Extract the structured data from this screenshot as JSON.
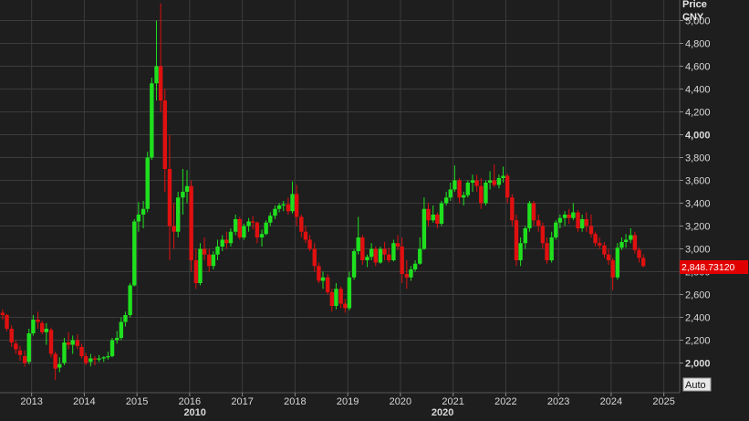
{
  "axis": {
    "price_label": "Price",
    "currency_label": "CNY",
    "auto_label": "Auto",
    "last_price_label": "2,848.73120"
  },
  "colors": {
    "background": "#1e1e1e",
    "grid": "#3c3c3c",
    "up": "#1fe01f",
    "down": "#e01010",
    "axis_text": "#d8d8d8",
    "price_tag": "#e00000"
  },
  "chart_data": {
    "type": "candlestick",
    "title": "",
    "ylabel": "Price CNY",
    "ylim": [
      1740,
      5180
    ],
    "xlim": [
      2012.4,
      2025.3
    ],
    "y_ticks": [
      {
        "value": 2000,
        "label": "2,000",
        "bold": true
      },
      {
        "value": 2200,
        "label": "2,200",
        "bold": false
      },
      {
        "value": 2400,
        "label": "2,400",
        "bold": false
      },
      {
        "value": 2600,
        "label": "2,600",
        "bold": false
      },
      {
        "value": 2800,
        "label": "2,800",
        "bold": false
      },
      {
        "value": 3000,
        "label": "3,000",
        "bold": false
      },
      {
        "value": 3200,
        "label": "3,200",
        "bold": false
      },
      {
        "value": 3400,
        "label": "3,400",
        "bold": false
      },
      {
        "value": 3600,
        "label": "3,600",
        "bold": false
      },
      {
        "value": 3800,
        "label": "3,800",
        "bold": false
      },
      {
        "value": 4000,
        "label": "4,000",
        "bold": true
      },
      {
        "value": 4200,
        "label": "4,200",
        "bold": false
      },
      {
        "value": 4400,
        "label": "4,400",
        "bold": false
      },
      {
        "value": 4600,
        "label": "4,600",
        "bold": false
      },
      {
        "value": 4800,
        "label": "4,800",
        "bold": false
      },
      {
        "value": 5000,
        "label": "5,000",
        "bold": false
      }
    ],
    "x_ticks": [
      {
        "value": 2013,
        "label": "2013"
      },
      {
        "value": 2014,
        "label": "2014"
      },
      {
        "value": 2015,
        "label": "2015"
      },
      {
        "value": 2016,
        "label": "2016"
      },
      {
        "value": 2017,
        "label": "2017"
      },
      {
        "value": 2018,
        "label": "2018"
      },
      {
        "value": 2019,
        "label": "2019"
      },
      {
        "value": 2020,
        "label": "2020"
      },
      {
        "value": 2021,
        "label": "2021"
      },
      {
        "value": 2022,
        "label": "2022"
      },
      {
        "value": 2023,
        "label": "2023"
      },
      {
        "value": 2024,
        "label": "2024"
      },
      {
        "value": 2025,
        "label": "2025"
      }
    ],
    "decade_labels": [
      {
        "value": 2010,
        "label": "2010",
        "x_position": 2016.1
      },
      {
        "value": 2020,
        "label": "2020",
        "x_position": 2020.8
      }
    ],
    "last_price": 2848.7312,
    "candles": [
      [
        2012.45,
        2440,
        2470,
        2380,
        2420
      ],
      [
        2012.53,
        2420,
        2430,
        2280,
        2300
      ],
      [
        2012.62,
        2300,
        2330,
        2140,
        2180
      ],
      [
        2012.7,
        2170,
        2200,
        2080,
        2120
      ],
      [
        2012.78,
        2110,
        2150,
        2020,
        2070
      ],
      [
        2012.87,
        2060,
        2110,
        1970,
        2000
      ],
      [
        2012.95,
        2010,
        2300,
        1990,
        2260
      ],
      [
        2013.03,
        2260,
        2420,
        2240,
        2380
      ],
      [
        2013.12,
        2380,
        2450,
        2300,
        2360
      ],
      [
        2013.2,
        2350,
        2370,
        2250,
        2270
      ],
      [
        2013.28,
        2270,
        2350,
        2160,
        2300
      ],
      [
        2013.37,
        2290,
        2310,
        2050,
        2080
      ],
      [
        2013.45,
        2080,
        2100,
        1850,
        1950
      ],
      [
        2013.53,
        1960,
        2050,
        1920,
        1990
      ],
      [
        2013.62,
        2000,
        2220,
        1980,
        2180
      ],
      [
        2013.7,
        2180,
        2270,
        2120,
        2160
      ],
      [
        2013.78,
        2160,
        2240,
        2080,
        2200
      ],
      [
        2013.87,
        2200,
        2250,
        2120,
        2150
      ],
      [
        2013.95,
        2140,
        2170,
        2040,
        2060
      ],
      [
        2014.03,
        2060,
        2090,
        1980,
        2000
      ],
      [
        2014.12,
        2010,
        2080,
        1970,
        2040
      ],
      [
        2014.2,
        2040,
        2060,
        1980,
        2030
      ],
      [
        2014.28,
        2030,
        2070,
        2010,
        2040
      ],
      [
        2014.37,
        2040,
        2060,
        2010,
        2050
      ],
      [
        2014.45,
        2050,
        2100,
        2030,
        2060
      ],
      [
        2014.53,
        2060,
        2220,
        2050,
        2200
      ],
      [
        2014.62,
        2200,
        2280,
        2170,
        2220
      ],
      [
        2014.7,
        2220,
        2400,
        2200,
        2360
      ],
      [
        2014.78,
        2360,
        2450,
        2320,
        2420
      ],
      [
        2014.87,
        2420,
        2700,
        2400,
        2680
      ],
      [
        2014.95,
        2680,
        3260,
        2670,
        3240
      ],
      [
        2015.03,
        3240,
        3410,
        3150,
        3300
      ],
      [
        2015.12,
        3300,
        3420,
        3180,
        3350
      ],
      [
        2015.2,
        3350,
        3850,
        3320,
        3800
      ],
      [
        2015.28,
        3800,
        4500,
        3780,
        4450
      ],
      [
        2015.37,
        4450,
        5000,
        4300,
        4600
      ],
      [
        2015.45,
        4600,
        5150,
        4200,
        4300
      ],
      [
        2015.53,
        4300,
        4400,
        3500,
        3700
      ],
      [
        2015.62,
        3700,
        4000,
        2900,
        3200
      ],
      [
        2015.7,
        3200,
        3400,
        3000,
        3150
      ],
      [
        2015.78,
        3150,
        3500,
        3100,
        3450
      ],
      [
        2015.87,
        3450,
        3700,
        3300,
        3500
      ],
      [
        2015.95,
        3500,
        3690,
        3400,
        3550
      ],
      [
        2016.03,
        3550,
        3600,
        2800,
        2900
      ],
      [
        2016.12,
        2900,
        3000,
        2650,
        2700
      ],
      [
        2016.2,
        2700,
        3050,
        2680,
        3000
      ],
      [
        2016.28,
        3000,
        3100,
        2900,
        2950
      ],
      [
        2016.37,
        2950,
        3000,
        2800,
        2850
      ],
      [
        2016.45,
        2850,
        2980,
        2820,
        2950
      ],
      [
        2016.53,
        2950,
        3080,
        2900,
        3020
      ],
      [
        2016.62,
        3020,
        3120,
        2980,
        3080
      ],
      [
        2016.7,
        3080,
        3150,
        3000,
        3050
      ],
      [
        2016.78,
        3050,
        3180,
        3020,
        3150
      ],
      [
        2016.87,
        3150,
        3300,
        3120,
        3260
      ],
      [
        2016.95,
        3260,
        3280,
        3080,
        3100
      ],
      [
        2017.03,
        3100,
        3220,
        3080,
        3200
      ],
      [
        2017.12,
        3200,
        3270,
        3150,
        3240
      ],
      [
        2017.2,
        3240,
        3290,
        3170,
        3230
      ],
      [
        2017.28,
        3230,
        3240,
        3050,
        3100
      ],
      [
        2017.37,
        3100,
        3170,
        3020,
        3130
      ],
      [
        2017.45,
        3130,
        3250,
        3120,
        3230
      ],
      [
        2017.53,
        3230,
        3320,
        3200,
        3290
      ],
      [
        2017.62,
        3290,
        3380,
        3260,
        3350
      ],
      [
        2017.7,
        3350,
        3400,
        3320,
        3380
      ],
      [
        2017.78,
        3380,
        3420,
        3330,
        3390
      ],
      [
        2017.87,
        3390,
        3450,
        3300,
        3330
      ],
      [
        2017.95,
        3330,
        3590,
        3310,
        3480
      ],
      [
        2018.03,
        3480,
        3560,
        3200,
        3280
      ],
      [
        2018.12,
        3280,
        3300,
        3100,
        3150
      ],
      [
        2018.2,
        3150,
        3200,
        3050,
        3080
      ],
      [
        2018.28,
        3080,
        3120,
        2980,
        3000
      ],
      [
        2018.37,
        3000,
        3050,
        2800,
        2850
      ],
      [
        2018.45,
        2850,
        2880,
        2700,
        2720
      ],
      [
        2018.53,
        2720,
        2800,
        2650,
        2750
      ],
      [
        2018.62,
        2750,
        2780,
        2600,
        2620
      ],
      [
        2018.7,
        2620,
        2650,
        2450,
        2500
      ],
      [
        2018.78,
        2500,
        2700,
        2470,
        2650
      ],
      [
        2018.87,
        2650,
        2670,
        2480,
        2520
      ],
      [
        2018.95,
        2520,
        2560,
        2440,
        2480
      ],
      [
        2019.03,
        2480,
        2800,
        2460,
        2750
      ],
      [
        2019.12,
        2750,
        3000,
        2730,
        2980
      ],
      [
        2019.2,
        2980,
        3280,
        2950,
        3100
      ],
      [
        2019.28,
        3100,
        3120,
        2860,
        2900
      ],
      [
        2019.37,
        2900,
        2950,
        2840,
        2930
      ],
      [
        2019.45,
        2930,
        3050,
        2900,
        3000
      ],
      [
        2019.53,
        3000,
        3020,
        2850,
        2880
      ],
      [
        2019.62,
        2880,
        3020,
        2870,
        3000
      ],
      [
        2019.7,
        3000,
        3060,
        2900,
        2950
      ],
      [
        2019.78,
        2950,
        3010,
        2880,
        2900
      ],
      [
        2019.87,
        2900,
        3080,
        2890,
        3050
      ],
      [
        2019.95,
        3050,
        3120,
        2990,
        3020
      ],
      [
        2020.03,
        3020,
        3100,
        2700,
        2780
      ],
      [
        2020.12,
        2780,
        2900,
        2650,
        2750
      ],
      [
        2020.2,
        2750,
        2850,
        2720,
        2820
      ],
      [
        2020.28,
        2820,
        2900,
        2800,
        2870
      ],
      [
        2020.37,
        2870,
        3100,
        2860,
        3000
      ],
      [
        2020.45,
        3000,
        3450,
        2990,
        3350
      ],
      [
        2020.53,
        3350,
        3400,
        3200,
        3250
      ],
      [
        2020.62,
        3250,
        3380,
        3230,
        3300
      ],
      [
        2020.7,
        3300,
        3320,
        3180,
        3220
      ],
      [
        2020.78,
        3220,
        3420,
        3200,
        3400
      ],
      [
        2020.87,
        3400,
        3500,
        3380,
        3450
      ],
      [
        2020.95,
        3450,
        3580,
        3420,
        3520
      ],
      [
        2021.03,
        3520,
        3730,
        3500,
        3600
      ],
      [
        2021.12,
        3600,
        3620,
        3400,
        3450
      ],
      [
        2021.2,
        3450,
        3500,
        3380,
        3470
      ],
      [
        2021.28,
        3470,
        3600,
        3450,
        3580
      ],
      [
        2021.37,
        3580,
        3650,
        3500,
        3600
      ],
      [
        2021.45,
        3600,
        3650,
        3500,
        3550
      ],
      [
        2021.53,
        3550,
        3620,
        3350,
        3400
      ],
      [
        2021.62,
        3400,
        3600,
        3380,
        3580
      ],
      [
        2021.7,
        3580,
        3680,
        3520,
        3600
      ],
      [
        2021.78,
        3600,
        3740,
        3540,
        3560
      ],
      [
        2021.87,
        3560,
        3650,
        3530,
        3620
      ],
      [
        2021.95,
        3620,
        3720,
        3580,
        3640
      ],
      [
        2022.03,
        3640,
        3660,
        3400,
        3450
      ],
      [
        2022.12,
        3450,
        3480,
        3200,
        3250
      ],
      [
        2022.2,
        3250,
        3300,
        2850,
        2900
      ],
      [
        2022.28,
        2900,
        3100,
        2850,
        3050
      ],
      [
        2022.37,
        3050,
        3200,
        3000,
        3180
      ],
      [
        2022.45,
        3180,
        3420,
        3150,
        3400
      ],
      [
        2022.53,
        3400,
        3420,
        3200,
        3250
      ],
      [
        2022.62,
        3250,
        3300,
        3150,
        3200
      ],
      [
        2022.7,
        3200,
        3230,
        3000,
        3050
      ],
      [
        2022.78,
        3050,
        3100,
        2870,
        2900
      ],
      [
        2022.87,
        2900,
        3150,
        2880,
        3100
      ],
      [
        2022.95,
        3100,
        3250,
        3080,
        3230
      ],
      [
        2023.03,
        3230,
        3300,
        3180,
        3270
      ],
      [
        2023.12,
        3270,
        3330,
        3200,
        3300
      ],
      [
        2023.2,
        3300,
        3350,
        3220,
        3270
      ],
      [
        2023.28,
        3270,
        3400,
        3250,
        3320
      ],
      [
        2023.37,
        3320,
        3340,
        3150,
        3180
      ],
      [
        2023.45,
        3180,
        3300,
        3150,
        3260
      ],
      [
        2023.53,
        3260,
        3320,
        3150,
        3200
      ],
      [
        2023.62,
        3200,
        3300,
        3100,
        3130
      ],
      [
        2023.7,
        3130,
        3150,
        3020,
        3050
      ],
      [
        2023.78,
        3050,
        3100,
        3000,
        3030
      ],
      [
        2023.87,
        3030,
        3060,
        2920,
        2950
      ],
      [
        2023.95,
        2950,
        3000,
        2860,
        2900
      ],
      [
        2024.03,
        2900,
        2920,
        2640,
        2750
      ],
      [
        2024.12,
        2750,
        3050,
        2730,
        3010
      ],
      [
        2024.2,
        3010,
        3100,
        2990,
        3060
      ],
      [
        2024.28,
        3060,
        3130,
        3010,
        3080
      ],
      [
        2024.37,
        3080,
        3180,
        3050,
        3120
      ],
      [
        2024.45,
        3120,
        3150,
        2960,
        2990
      ],
      [
        2024.53,
        2990,
        3010,
        2880,
        2920
      ],
      [
        2024.61,
        2920,
        2950,
        2840,
        2849
      ]
    ]
  }
}
